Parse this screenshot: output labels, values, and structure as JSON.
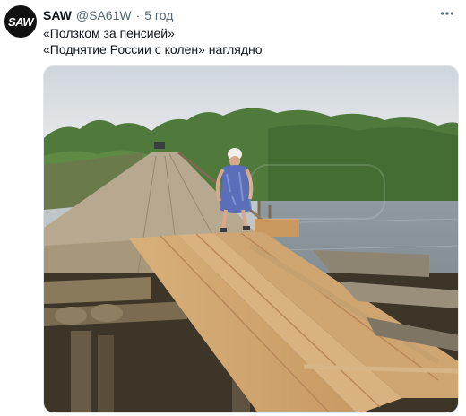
{
  "tweet": {
    "author": {
      "avatar_text": "SAW",
      "name": "SAW",
      "handle": "@SA61W",
      "separator": "·",
      "time": "5 год"
    },
    "text_lines": [
      "«Ползком за пенсией»",
      "«Поднятие России с колен» наглядно"
    ],
    "more_icon": "more-horizontal-icon",
    "media": {
      "kind": "photo"
    }
  }
}
